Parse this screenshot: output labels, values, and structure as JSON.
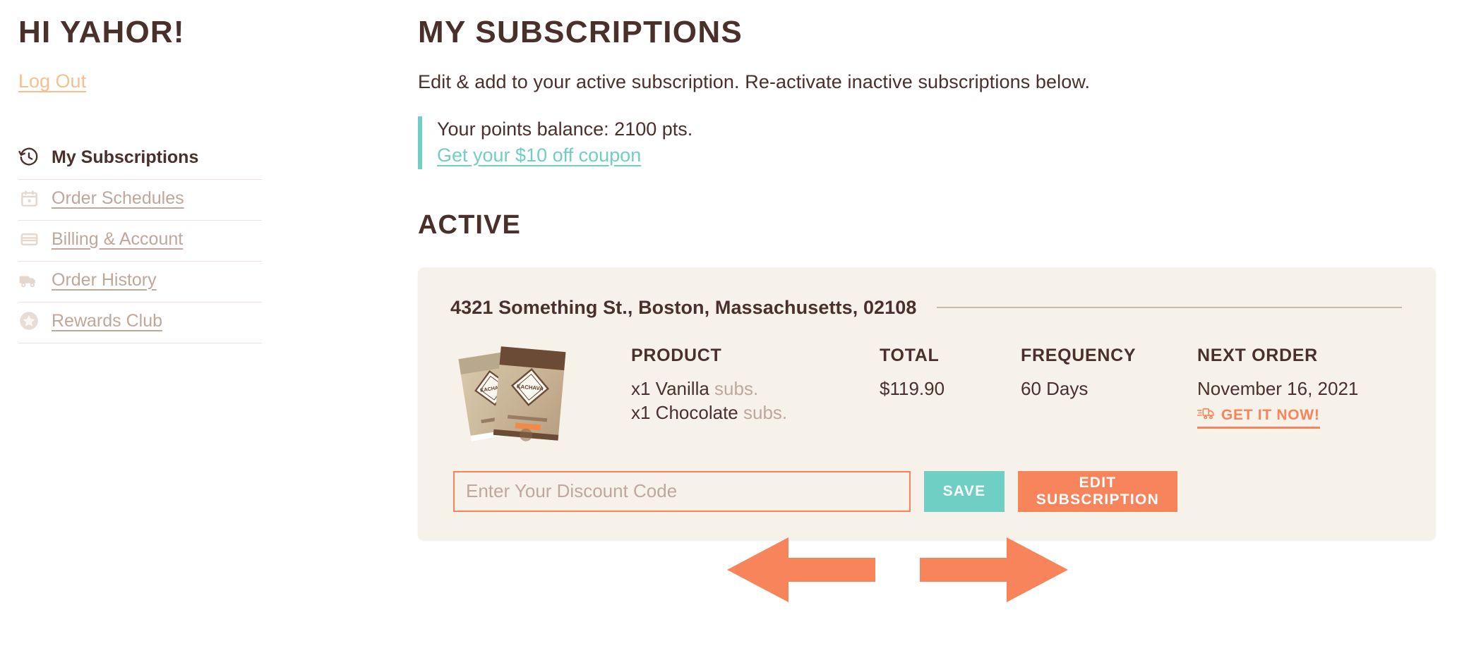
{
  "sidebar": {
    "greeting": "HI YAHOR!",
    "logout_label": "Log Out",
    "items": [
      {
        "label": "My Subscriptions",
        "icon": "history-clock-icon",
        "active": true
      },
      {
        "label": "Order Schedules",
        "icon": "calendar-icon",
        "active": false
      },
      {
        "label": "Billing & Account",
        "icon": "credit-card-icon",
        "active": false
      },
      {
        "label": "Order History",
        "icon": "truck-icon",
        "active": false
      },
      {
        "label": "Rewards Club",
        "icon": "star-badge-icon",
        "active": false
      }
    ]
  },
  "main": {
    "title": "MY SUBSCRIPTIONS",
    "subtitle": "Edit & add to your active subscription. Re-activate inactive subscriptions below.",
    "points": {
      "balance_text": "Your points balance: 2100 pts.",
      "coupon_link": "Get your $10 off coupon",
      "accent_color": "#6fcfc4"
    },
    "section_title": "ACTIVE"
  },
  "card": {
    "address": "4321 Something St., Boston, Massachusetts, 02108",
    "columns": {
      "product": "PRODUCT",
      "total": "TOTAL",
      "frequency": "FREQUENCY",
      "next_order": "NEXT ORDER"
    },
    "products": [
      {
        "qty_name": "x1 Vanilla",
        "suffix": "subs."
      },
      {
        "qty_name": "x1 Chocolate",
        "suffix": "subs."
      }
    ],
    "total": "$119.90",
    "frequency": "60 Days",
    "next_order_date": "November 16, 2021",
    "get_it_now_label": "GET IT NOW!",
    "get_it_now_icon": "fast-truck-icon",
    "discount_input_value": "",
    "discount_input_placeholder": "Enter Your Discount Code",
    "save_label": "SAVE",
    "edit_label": "EDIT SUBSCRIPTION"
  },
  "colors": {
    "brand_orange": "#f7845a",
    "brand_teal": "#6fcfc4",
    "text_brown": "#4a302b",
    "muted_tan": "#bfa79c",
    "card_bg": "#f6f2ea"
  },
  "annotations": {
    "left_arrow": "left-pointing-arrow-annotation",
    "right_arrow": "right-pointing-arrow-annotation"
  }
}
